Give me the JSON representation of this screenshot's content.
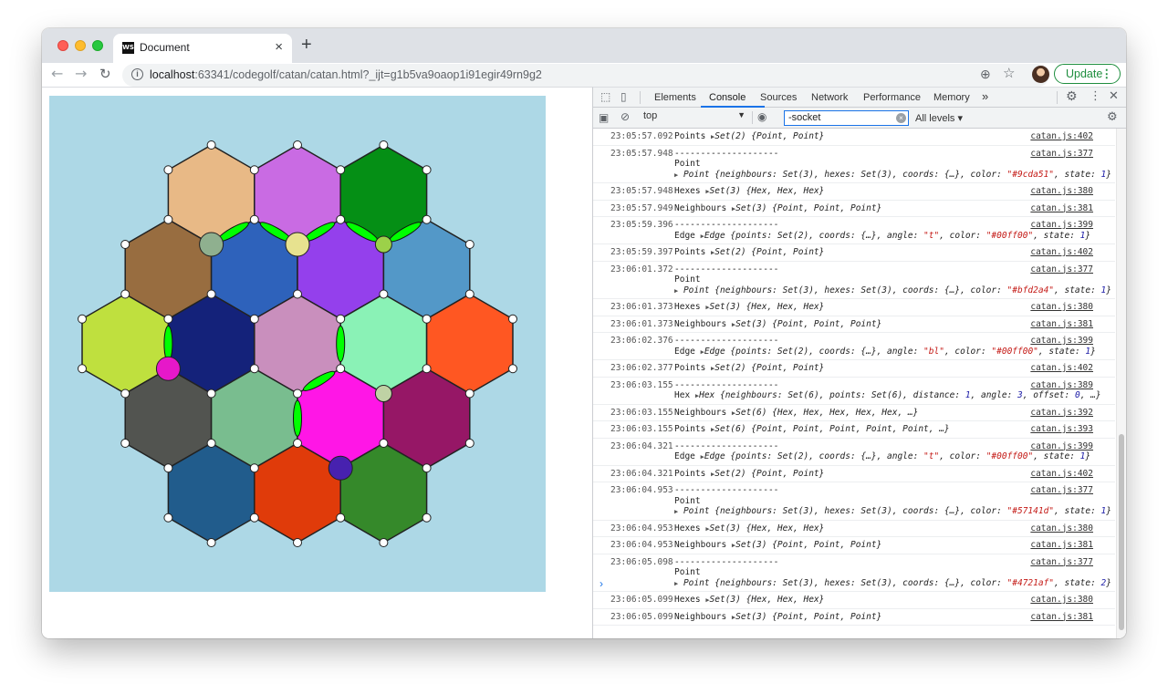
{
  "browser": {
    "tab_title": "Document",
    "tab_favicon_text": "WS",
    "url_host": "localhost",
    "url_rest": ":63341/codegolf/catan/catan.html?_ijt=g1b5va9oaop1i91egir49rn9g2",
    "update_label": "Update"
  },
  "devtools": {
    "tabs": [
      "Elements",
      "Console",
      "Sources",
      "Network",
      "Performance",
      "Memory"
    ],
    "more_tabs": "»",
    "context": "top",
    "filter": "-socket",
    "levels": "All levels ▾"
  },
  "colors": {
    "board_bg": "#add8e6",
    "edge_green": "#00ff00",
    "hex_fills": [
      "#e8b986",
      "#c96be3",
      "#058f15",
      "#986d40",
      "#2e62bb",
      "#9440ec",
      "#5398c8",
      "#bfe03e",
      "#14227a",
      "#c98fbd",
      "#8af2b6",
      "#ff5722",
      "#525450",
      "#79bd8f",
      "#ff16e6",
      "#961766",
      "#215c8c",
      "#e03b0a",
      "#35892a"
    ],
    "player_points": [
      "#8fb08f",
      "#e7e28f",
      "#9cd149",
      "#e618c9",
      "#bfd2a4",
      "#4721af"
    ]
  },
  "console": {
    "messages": [
      {
        "time": "23:05:57.092",
        "src": "catan.js:402",
        "lines": [
          [
            [
              "Points "
            ],
            [
              "▶",
              "tri"
            ],
            [
              "Set(2) {Point, Point}",
              "it"
            ]
          ]
        ]
      },
      {
        "time": "23:05:57.948",
        "src": "catan.js:377",
        "lines": [
          [
            [
              "--------------------"
            ]
          ],
          [
            [
              "Point"
            ]
          ],
          [
            [
              "▶",
              "tri"
            ],
            [
              " Point {neighbours: Set(3), hexes: Set(3), coords: {…}, color: ",
              "it"
            ],
            [
              "\"#9cda51\"",
              "str"
            ],
            [
              ", state: ",
              "it"
            ],
            [
              "1",
              "num"
            ],
            [
              "}",
              "it"
            ]
          ]
        ]
      },
      {
        "time": "23:05:57.948",
        "src": "catan.js:380",
        "lines": [
          [
            [
              "Hexes "
            ],
            [
              "▶",
              "tri"
            ],
            [
              "Set(3) {Hex, Hex, Hex}",
              "it"
            ]
          ]
        ]
      },
      {
        "time": "23:05:57.949",
        "src": "catan.js:381",
        "lines": [
          [
            [
              "Neighbours "
            ],
            [
              "▶",
              "tri"
            ],
            [
              "Set(3) {Point, Point, Point}",
              "it"
            ]
          ]
        ]
      },
      {
        "time": "23:05:59.396",
        "src": "catan.js:399",
        "lines": [
          [
            [
              "--------------------"
            ]
          ],
          [
            [
              "Edge "
            ],
            [
              "▶",
              "tri"
            ],
            [
              "Edge {points: Set(2), coords: {…}, angle: ",
              "it"
            ],
            [
              "\"t\"",
              "str"
            ],
            [
              ", color: ",
              "it"
            ],
            [
              "\"#00ff00\"",
              "str"
            ],
            [
              ", state: ",
              "it"
            ],
            [
              "1",
              "num"
            ],
            [
              "}",
              "it"
            ]
          ]
        ]
      },
      {
        "time": "23:05:59.397",
        "src": "catan.js:402",
        "lines": [
          [
            [
              "Points "
            ],
            [
              "▶",
              "tri"
            ],
            [
              "Set(2) {Point, Point}",
              "it"
            ]
          ]
        ]
      },
      {
        "time": "23:06:01.372",
        "src": "catan.js:377",
        "lines": [
          [
            [
              "--------------------"
            ]
          ],
          [
            [
              "Point"
            ]
          ],
          [
            [
              "▶",
              "tri"
            ],
            [
              " Point {neighbours: Set(3), hexes: Set(3), coords: {…}, color: ",
              "it"
            ],
            [
              "\"#bfd2a4\"",
              "str"
            ],
            [
              ", state: ",
              "it"
            ],
            [
              "1",
              "num"
            ],
            [
              "}",
              "it"
            ]
          ]
        ]
      },
      {
        "time": "23:06:01.373",
        "src": "catan.js:380",
        "lines": [
          [
            [
              "Hexes "
            ],
            [
              "▶",
              "tri"
            ],
            [
              "Set(3) {Hex, Hex, Hex}",
              "it"
            ]
          ]
        ]
      },
      {
        "time": "23:06:01.373",
        "src": "catan.js:381",
        "lines": [
          [
            [
              "Neighbours "
            ],
            [
              "▶",
              "tri"
            ],
            [
              "Set(3) {Point, Point, Point}",
              "it"
            ]
          ]
        ]
      },
      {
        "time": "23:06:02.376",
        "src": "catan.js:399",
        "lines": [
          [
            [
              "--------------------"
            ]
          ],
          [
            [
              "Edge "
            ],
            [
              "▶",
              "tri"
            ],
            [
              "Edge {points: Set(2), coords: {…}, angle: ",
              "it"
            ],
            [
              "\"bl\"",
              "str"
            ],
            [
              ", color: ",
              "it"
            ],
            [
              "\"#00ff00\"",
              "str"
            ],
            [
              ", state: ",
              "it"
            ],
            [
              "1",
              "num"
            ],
            [
              "}",
              "it"
            ]
          ]
        ]
      },
      {
        "time": "23:06:02.377",
        "src": "catan.js:402",
        "lines": [
          [
            [
              "Points "
            ],
            [
              "▶",
              "tri"
            ],
            [
              "Set(2) {Point, Point}",
              "it"
            ]
          ]
        ]
      },
      {
        "time": "23:06:03.155",
        "src": "catan.js:389",
        "lines": [
          [
            [
              "--------------------"
            ]
          ],
          [
            [
              "Hex "
            ],
            [
              "▶",
              "tri"
            ],
            [
              "Hex {neighbours: Set(6), points: Set(6), distance: ",
              "it"
            ],
            [
              "1",
              "num"
            ],
            [
              ", angle: ",
              "it"
            ],
            [
              "3",
              "num"
            ],
            [
              ", offset: ",
              "it"
            ],
            [
              "0",
              "num"
            ],
            [
              ", …}",
              "it"
            ]
          ]
        ]
      },
      {
        "time": "23:06:03.155",
        "src": "catan.js:392",
        "lines": [
          [
            [
              "Neighbours "
            ],
            [
              "▶",
              "tri"
            ],
            [
              "Set(6) {Hex, Hex, Hex, Hex, Hex, …}",
              "it"
            ]
          ]
        ]
      },
      {
        "time": "23:06:03.155",
        "src": "catan.js:393",
        "lines": [
          [
            [
              "Points "
            ],
            [
              "▶",
              "tri"
            ],
            [
              "Set(6) {Point, Point, Point, Point, Point, …}",
              "it"
            ]
          ]
        ]
      },
      {
        "time": "23:06:04.321",
        "src": "catan.js:399",
        "lines": [
          [
            [
              "--------------------"
            ]
          ],
          [
            [
              "Edge "
            ],
            [
              "▶",
              "tri"
            ],
            [
              "Edge {points: Set(2), coords: {…}, angle: ",
              "it"
            ],
            [
              "\"t\"",
              "str"
            ],
            [
              ", color: ",
              "it"
            ],
            [
              "\"#00ff00\"",
              "str"
            ],
            [
              ", state: ",
              "it"
            ],
            [
              "1",
              "num"
            ],
            [
              "}",
              "it"
            ]
          ]
        ]
      },
      {
        "time": "23:06:04.321",
        "src": "catan.js:402",
        "lines": [
          [
            [
              "Points "
            ],
            [
              "▶",
              "tri"
            ],
            [
              "Set(2) {Point, Point}",
              "it"
            ]
          ]
        ]
      },
      {
        "time": "23:06:04.953",
        "src": "catan.js:377",
        "lines": [
          [
            [
              "--------------------"
            ]
          ],
          [
            [
              "Point"
            ]
          ],
          [
            [
              "▶",
              "tri"
            ],
            [
              " Point {neighbours: Set(3), hexes: Set(3), coords: {…}, color: ",
              "it"
            ],
            [
              "\"#57141d\"",
              "str"
            ],
            [
              ", state: ",
              "it"
            ],
            [
              "1",
              "num"
            ],
            [
              "}",
              "it"
            ]
          ]
        ]
      },
      {
        "time": "23:06:04.953",
        "src": "catan.js:380",
        "lines": [
          [
            [
              "Hexes "
            ],
            [
              "▶",
              "tri"
            ],
            [
              "Set(3) {Hex, Hex, Hex}",
              "it"
            ]
          ]
        ]
      },
      {
        "time": "23:06:04.953",
        "src": "catan.js:381",
        "lines": [
          [
            [
              "Neighbours "
            ],
            [
              "▶",
              "tri"
            ],
            [
              "Set(3) {Point, Point, Point}",
              "it"
            ]
          ]
        ]
      },
      {
        "time": "23:06:05.098",
        "src": "catan.js:377",
        "lines": [
          [
            [
              "--------------------"
            ]
          ],
          [
            [
              "Point"
            ]
          ],
          [
            [
              "▶",
              "tri"
            ],
            [
              " Point {neighbours: Set(3), hexes: Set(3), coords: {…}, color: ",
              "it"
            ],
            [
              "\"#4721af\"",
              "str"
            ],
            [
              ", state: ",
              "it"
            ],
            [
              "2",
              "num"
            ],
            [
              "}",
              "it"
            ]
          ]
        ]
      },
      {
        "time": "23:06:05.099",
        "src": "catan.js:380",
        "lines": [
          [
            [
              "Hexes "
            ],
            [
              "▶",
              "tri"
            ],
            [
              "Set(3) {Hex, Hex, Hex}",
              "it"
            ]
          ]
        ]
      },
      {
        "time": "23:06:05.099",
        "src": "catan.js:381",
        "lines": [
          [
            [
              "Neighbours "
            ],
            [
              "▶",
              "tri"
            ],
            [
              "Set(3) {Point, Point, Point}",
              "it"
            ]
          ]
        ]
      }
    ],
    "prompt": "›"
  }
}
